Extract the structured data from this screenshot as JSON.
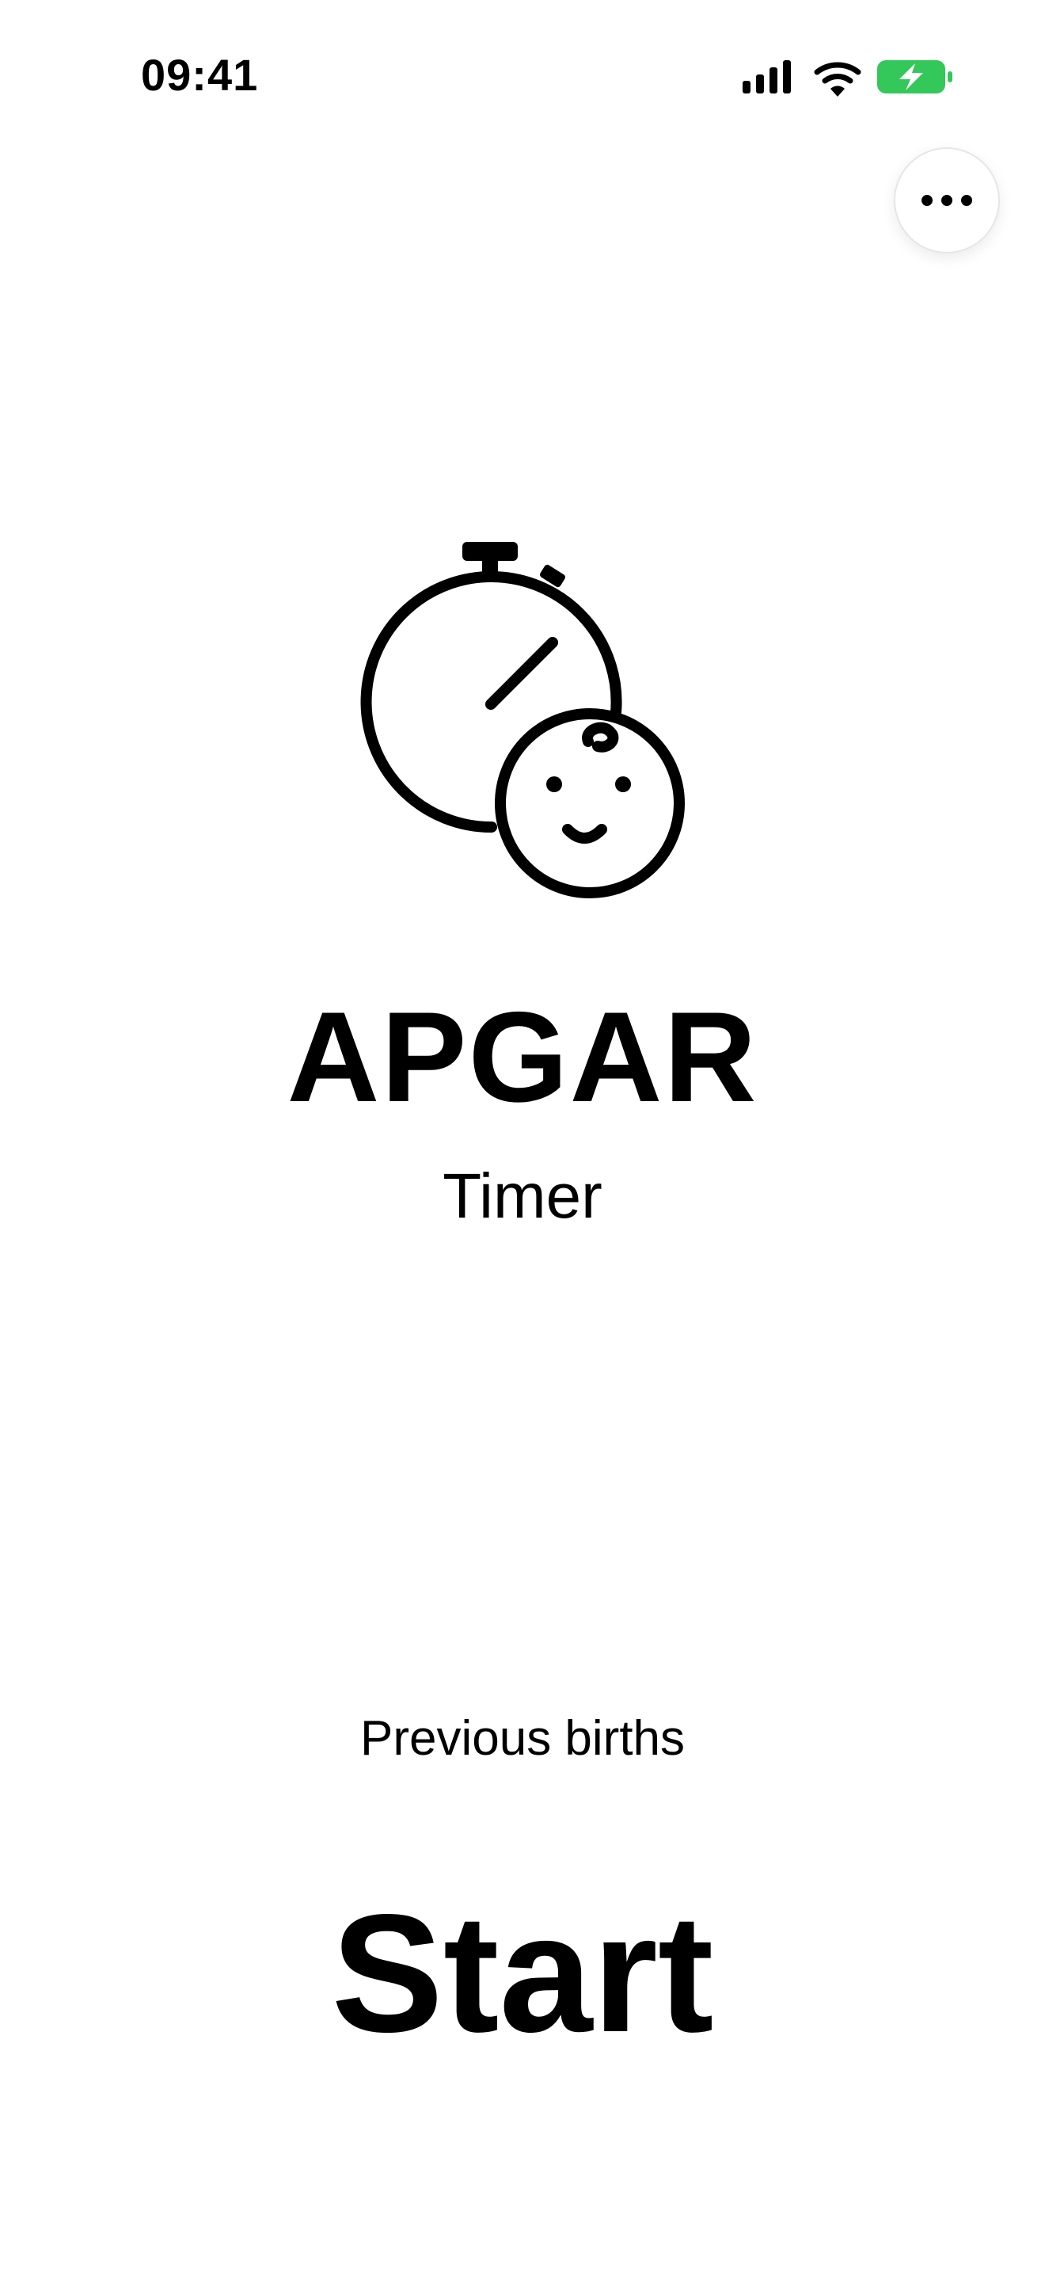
{
  "status_bar": {
    "time": "09:41",
    "icons": [
      "signal-icon",
      "wifi-icon",
      "battery-charging-icon"
    ],
    "battery_color": "#34C759"
  },
  "toolbar": {
    "more_icon": "ellipsis-icon"
  },
  "hero": {
    "logo_icon": "stopwatch-baby-icon",
    "title": "APGAR",
    "subtitle": "Timer"
  },
  "actions": {
    "previous_births": "Previous births",
    "start": "Start"
  }
}
